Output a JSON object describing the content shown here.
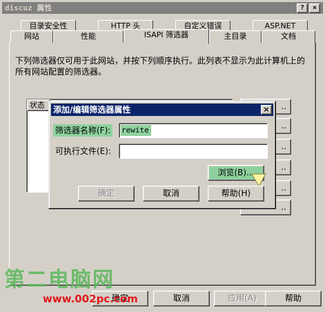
{
  "window": {
    "title": "discuz 属性",
    "help_btn": "?",
    "close_btn": "×"
  },
  "tabs_row1": [
    "目录安全性",
    "HTTP 头",
    "自定义错误",
    "ASP.NET"
  ],
  "tabs_row2": [
    "网站",
    "性能",
    "ISAPI 筛选器",
    "主目录",
    "文档"
  ],
  "panel": {
    "description": "下列筛选器仅可用于此网站，并按下列顺序执行。此列表不显示为此计算机上的所有网站配置的筛选器。",
    "list_header": "状态",
    "side_buttons": [
      "..",
      "..",
      "..",
      "..",
      "..",
      "..",
      ".."
    ]
  },
  "bottom_buttons": {
    "ok": "确定",
    "cancel": "取消",
    "apply": "应用(A)",
    "help": "帮助"
  },
  "dialog": {
    "title": "添加/编辑筛选器属性",
    "close": "×",
    "filter_name_label": "筛选器名称(F):",
    "filter_name_value": "rewite",
    "exe_label": "可执行文件(E):",
    "exe_value": "",
    "browse": "浏览(B)...",
    "ok": "确定",
    "cancel": "取消",
    "help": "帮助(H)"
  },
  "watermark": {
    "logo_text": "第二电脑网",
    "url": "www.002pc.com"
  },
  "colors": {
    "title_inactive": "#808080",
    "title_active": "#0a246a",
    "highlight": "#8fd19e",
    "watermark_green": "#5cb85c",
    "watermark_red": "#e0191d"
  }
}
